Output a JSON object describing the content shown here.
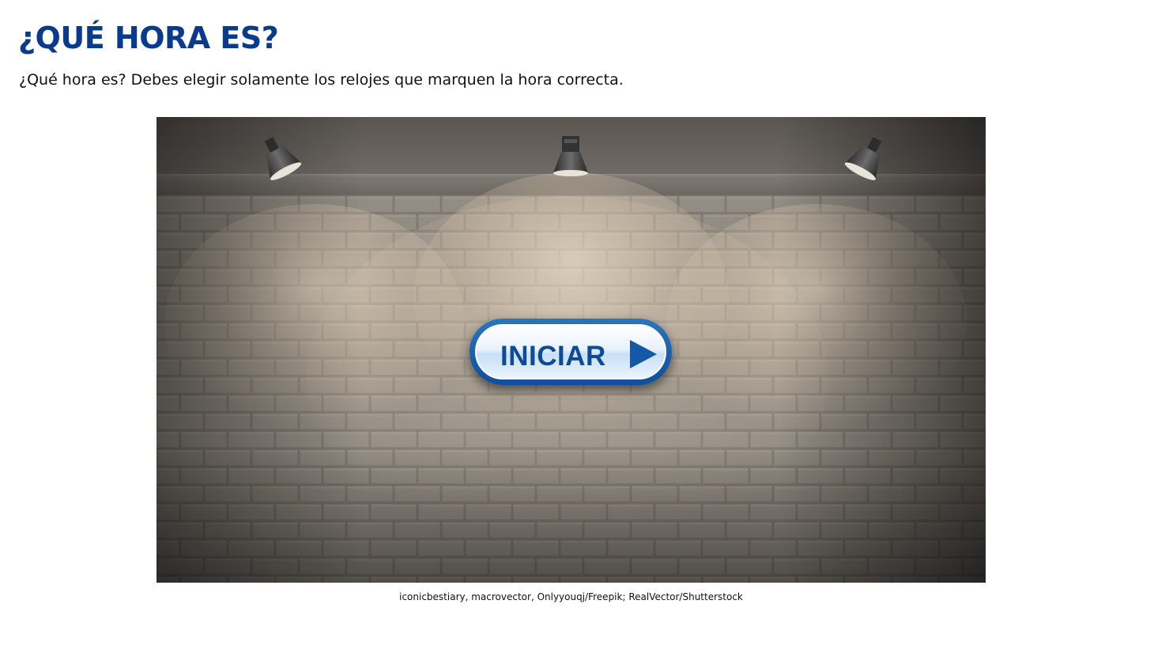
{
  "page": {
    "title": "¿QUÉ HORA ES?",
    "instructions": "¿Qué hora es? Debes elegir solamente los relojes que marquen la hora correcta."
  },
  "activity": {
    "start_button_label": "INICIAR",
    "start_button_icon": "play-icon",
    "background": "brick-wall-with-spotlights",
    "credits": "iconicbestiary, macrovector, Onlyyouqj/Freepik; RealVector/Shutterstock"
  },
  "colors": {
    "title": "#0a3a8c",
    "button_border": "#1e63b3",
    "button_text": "#0f4a94",
    "wall": "#8a847c"
  }
}
